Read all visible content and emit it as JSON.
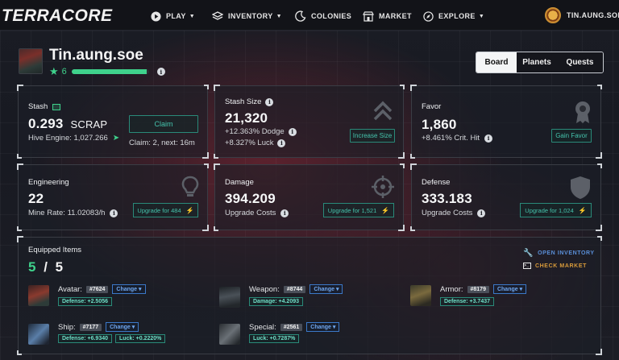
{
  "app": {
    "logo": "TERRACORE"
  },
  "nav": {
    "play": "PLAY",
    "inventory": "INVENTORY",
    "colonies": "COLONIES",
    "market": "MARKET",
    "explore": "EXPLORE",
    "user": "TIN.AUNG.SOE"
  },
  "profile": {
    "username": "Tin.aung.soe",
    "level": "6",
    "xp_progress": 0.97
  },
  "tabs": [
    "Board",
    "Planets",
    "Quests"
  ],
  "stash": {
    "label": "Stash",
    "value": "0.293",
    "unit": "SCRAP",
    "hive": "Hive Engine: 1,027.266",
    "claim_info": "Claim: 2, next: 16m",
    "claim_button": "Claim"
  },
  "stash_size": {
    "label": "Stash Size",
    "value": "21,320",
    "dodge": "+12.363% Dodge",
    "luck": "+8.327% Luck",
    "button": "Increase Size"
  },
  "favor": {
    "label": "Favor",
    "value": "1,860",
    "crit": "+8.461% Crit. Hit",
    "button": "Gain Favor"
  },
  "engineering": {
    "label": "Engineering",
    "value": "22",
    "rate": "Mine Rate: 11.02083/h",
    "button": "Upgrade for 484"
  },
  "damage": {
    "label": "Damage",
    "value": "394.209",
    "sub": "Upgrade Costs",
    "button": "Upgrade for 1,521"
  },
  "defense": {
    "label": "Defense",
    "value": "333.183",
    "sub": "Upgrade Costs",
    "button": "Upgrade for 1,024"
  },
  "equipped": {
    "title": "Equipped Items",
    "count_equipped": "5",
    "count_sep": "/",
    "count_total": "5",
    "open_inventory": "OPEN INVENTORY",
    "check_market": "CHECK MARKET",
    "change_label": "Change",
    "items": [
      {
        "name": "Avatar:",
        "id": "#7624",
        "stats": [
          "Defense: +2.5056"
        ]
      },
      {
        "name": "Weapon:",
        "id": "#8744",
        "stats": [
          "Damage: +4.2093"
        ]
      },
      {
        "name": "Armor:",
        "id": "#8179",
        "stats": [
          "Defense: +3.7437"
        ]
      },
      {
        "name": "Ship:",
        "id": "#7177",
        "stats": [
          "Defense: +6.9340",
          "Luck: +0.2220%"
        ]
      },
      {
        "name": "Special:",
        "id": "#2561",
        "stats": [
          "Luck: +0.7287%"
        ]
      }
    ]
  },
  "colors": {
    "accent_green": "#3fd28c",
    "teal": "#45c3ac",
    "blue": "#58a6ff",
    "bg": "#1a1c24"
  }
}
